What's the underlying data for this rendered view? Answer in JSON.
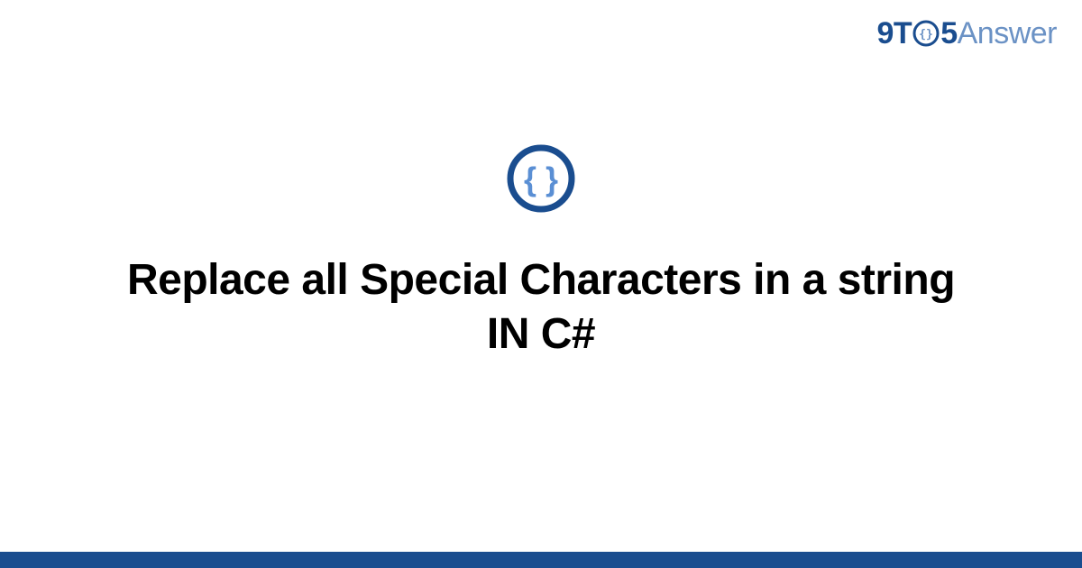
{
  "header": {
    "logo": {
      "part1": "9T",
      "part2": "5",
      "part3": "Answer"
    }
  },
  "main": {
    "title": "Replace all Special Characters in a string IN C#"
  },
  "colors": {
    "brand_dark": "#1a4d8f",
    "brand_light": "#6b92c5",
    "icon_accent": "#5a8fd4"
  }
}
